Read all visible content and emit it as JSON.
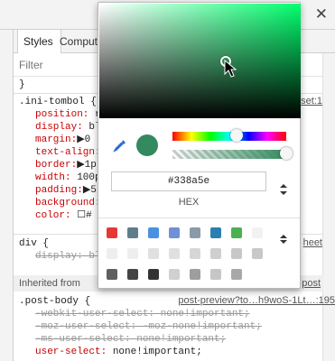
{
  "window": {
    "close_glyph": "✕"
  },
  "tabs": [
    {
      "label": "Styles"
    },
    {
      "label": "Comput"
    }
  ],
  "filter": {
    "placeholder": "Filter"
  },
  "add_rule": "+",
  "rules": [
    {
      "line": "}"
    },
    {
      "selector": ".ini-tombol {",
      "source": "set:1"
    },
    {
      "prop": "position:",
      "value": " r"
    },
    {
      "prop": "display:",
      "value": " bl"
    },
    {
      "prop": "margin:",
      "value": "▶0"
    },
    {
      "prop": "text-align:",
      "value": ""
    },
    {
      "prop": "border:",
      "value": "▶1p"
    },
    {
      "prop": "width:",
      "value": " 100p"
    },
    {
      "prop": "padding:",
      "value": "▶5"
    },
    {
      "prop": "background:",
      "value": ""
    },
    {
      "prop": "color:",
      "value": " ☐#"
    }
  ],
  "div_rule": {
    "selector": "div {",
    "struck_prop": "display:",
    "struck_value": " bl",
    "source": "heet"
  },
  "inherited": {
    "label": "Inherited from",
    "source": "post"
  },
  "post_body": {
    "selector": ".post-body {",
    "source": "post-preview?to…h9woS-1Lt…:195",
    "lines": [
      {
        "text": "-webkit-user-select: none!important;",
        "struck": true
      },
      {
        "text": "-moz-user-select: -moz-none!important;",
        "struck": true
      },
      {
        "text": "-ms-user-select: none!important;",
        "struck": true
      },
      {
        "prop": "user-select:",
        "value": " none!important;",
        "struck": false
      }
    ]
  },
  "picker": {
    "current_color": "#338a5e",
    "hue_fraction": 0.56,
    "alpha_fraction": 1.0,
    "hex_value": "#338a5e",
    "format_label": "HEX",
    "icons": {
      "eyedropper": "eyedropper-icon",
      "format_toggle": "updown-arrows-icon",
      "palette_toggle": "updown-arrows-icon"
    },
    "palette_rows": [
      [
        "#e53935",
        "#607d8b",
        "#4a90e2",
        "#6f8fd6",
        "#8a9aa8",
        "#2a7fb0",
        "#4caf50",
        "#f2f2f2"
      ],
      [
        "#eeeeee",
        "#eeeeee",
        "#e0e0e0",
        "#e0e0e0",
        "#d6d6d6",
        "#cfcfcf",
        "#c8c8c8",
        "#c8c8c8"
      ],
      [
        "#5f5f5f",
        "#444444",
        "#333333",
        "#d0d0d0",
        "#9e9e9e",
        "#c6c6c6",
        "#a8a8a8",
        ""
      ]
    ]
  }
}
